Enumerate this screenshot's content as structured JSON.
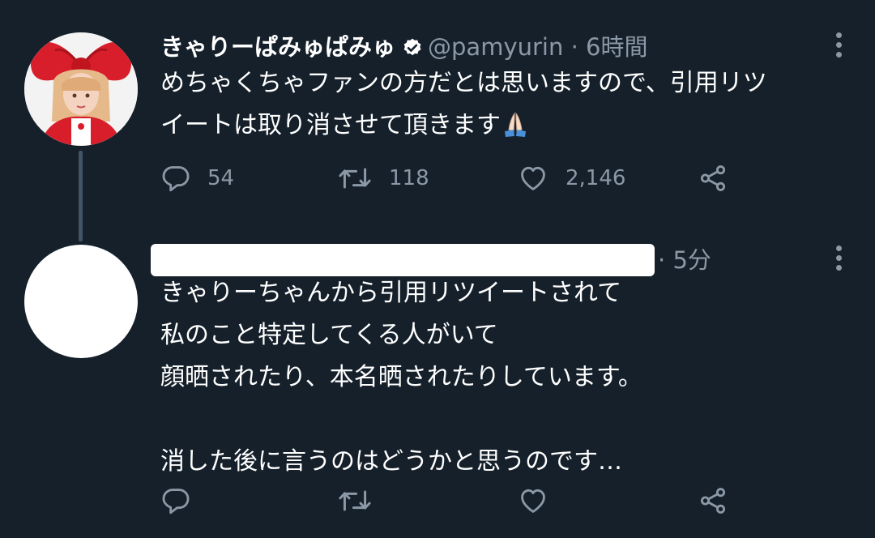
{
  "tweets": [
    {
      "author": {
        "display_name": "きゃりーぱみゅぱみゅ",
        "handle": "@pamyurin",
        "verified": true
      },
      "separator": "·",
      "time": "6時間",
      "text_lines": [
        "めちゃくちゃファンの方だとは思いますので、引用リツ",
        "イートは取り消させて頂きます"
      ],
      "emoji": "folded-hands",
      "stats": {
        "replies": "54",
        "retweets": "118",
        "likes": "2,146"
      }
    },
    {
      "author": {
        "display_name_redacted": true
      },
      "separator": "·",
      "time": "5分",
      "text": "きゃりーちゃんから引用リツイートされて\n私のこと特定してくる人がいて\n顔晒されたり、本名晒されたりしています。\n\n消した後に言うのはどうかと思うのです…"
    }
  ],
  "icons": {
    "reply": "reply-icon",
    "retweet": "retweet-icon",
    "like": "heart-icon",
    "share": "share-icon",
    "more": "more-vertical-icon",
    "verified": "verified-badge-icon"
  },
  "colors": {
    "background": "#15202b",
    "muted": "#8b98a5",
    "thread_line": "#425466",
    "bow_red": "#d81e2a"
  }
}
